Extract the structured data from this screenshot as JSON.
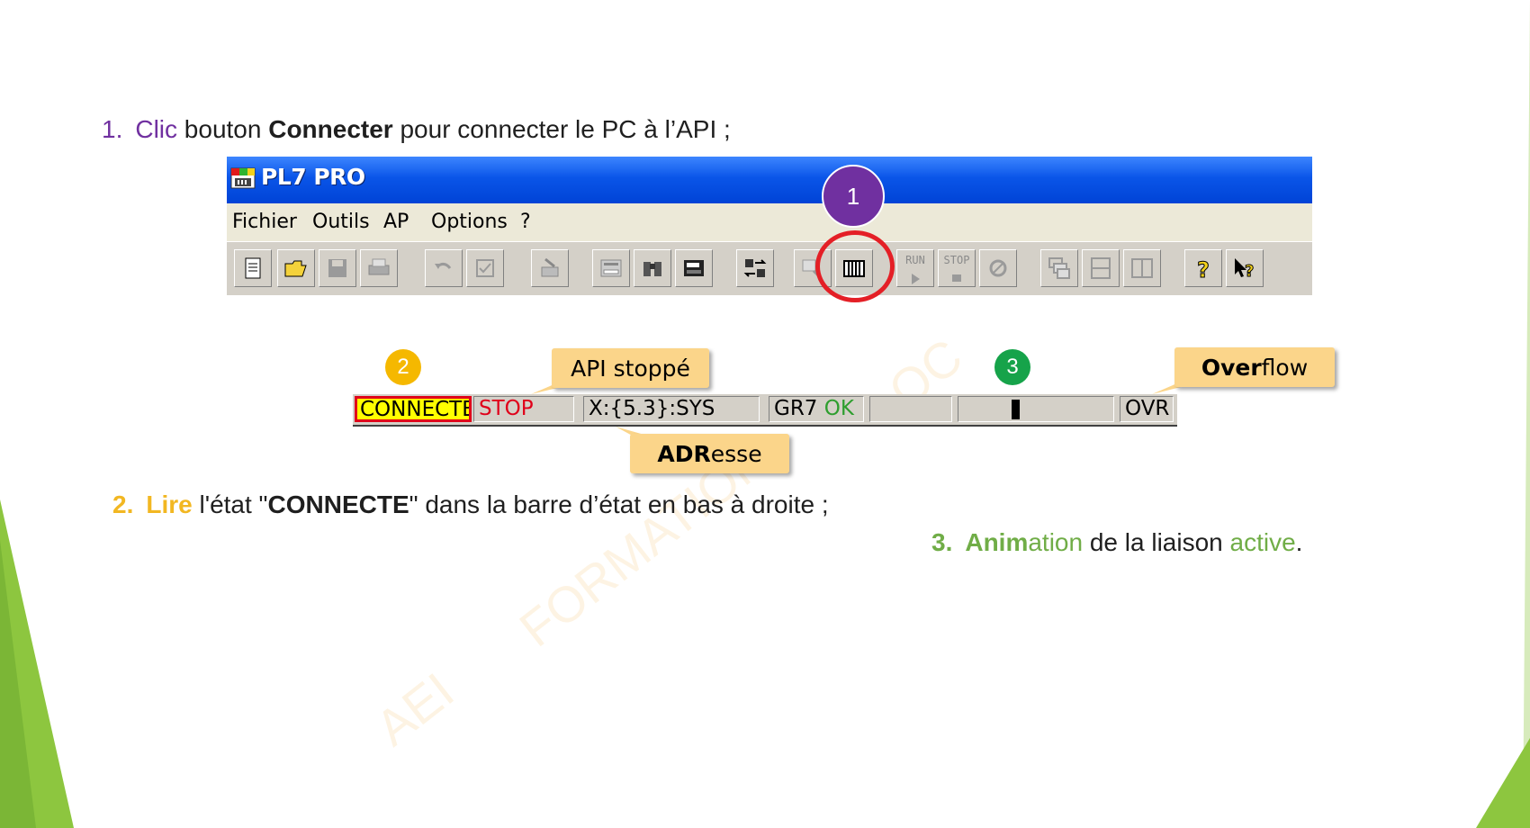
{
  "steps": {
    "s1": {
      "num": "1.",
      "verb": "Clic",
      "t1": " bouton ",
      "bold": "Connecter",
      "t2": " pour connecter le PC à l’API ;"
    },
    "s2": {
      "num": "2.",
      "verb": "Lire",
      "t1": " l'état \"",
      "bold": "CONNECTE",
      "t2": "\" dans la barre d’état en bas à droite ;"
    },
    "s3": {
      "num": "3.",
      "verb1": "Anim",
      "verb2": "ation",
      "t1": " de la liaison ",
      "verb3": "active",
      "t2": "."
    }
  },
  "window": {
    "title": "PL7 PRO",
    "menu": [
      "Fichier",
      "Outils",
      "AP",
      "Options",
      "?"
    ],
    "toolbar_buttons": [
      "new-document",
      "open-folder",
      "save",
      "print",
      "undo",
      "validate",
      "export",
      "print-preview",
      "find",
      "save-disk",
      "transfer",
      "magnifier",
      "connect",
      "run",
      "stop",
      "cycle",
      "cascade-windows",
      "tile-horizontal",
      "tile-vertical",
      "help",
      "context-help"
    ],
    "run_label": "RUN",
    "stop_label": "STOP"
  },
  "callouts": {
    "n1": "1",
    "n2": "2",
    "n3": "3",
    "api_stoppe": "API stoppé",
    "overflow_bold": "Over",
    "overflow_rest": "flow",
    "adresse_bold": "ADR",
    "adresse_rest": "esse"
  },
  "statusbar": {
    "connecte": "CONNECTE",
    "stop": "STOP",
    "address": "X:{5.3}:SYS",
    "gr7": "GR7",
    "ok": "OK",
    "ovr": "OVR"
  },
  "watermark": {
    "a": "AEI",
    "b": "FORMATION",
    "c": "OC"
  },
  "colors": {
    "purple": "#7030a0",
    "yellow": "#f2b722",
    "green": "#70ad47",
    "red": "#e41f26",
    "titlebar": "#0a55e8"
  }
}
